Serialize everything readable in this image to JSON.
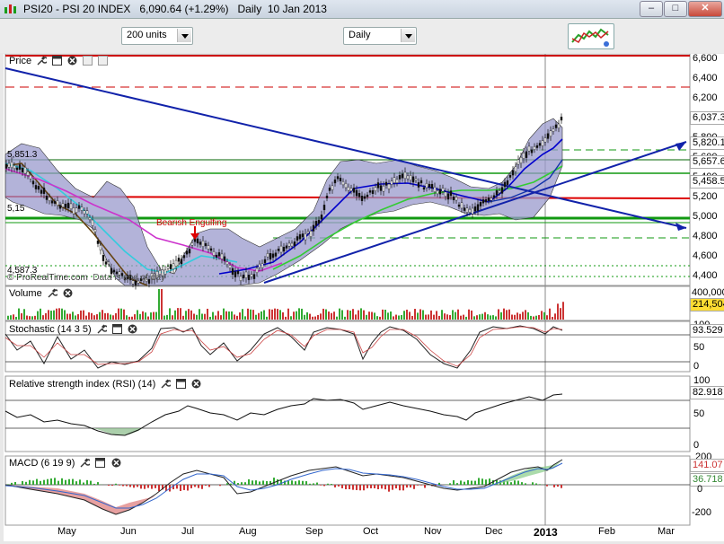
{
  "window": {
    "title": "PSI20 - PSI 20 INDEX",
    "last_price": "6,090.64",
    "change": "(+1.29%)",
    "period": "Daily",
    "date": "10 Jan 2013",
    "buttons": {
      "minimize": "–",
      "maximize": "□",
      "close": "✕"
    }
  },
  "toolbar": {
    "units_value": "200 units",
    "period_value": "Daily",
    "chart_type_icon": "chart-settings-icon"
  },
  "price_panel": {
    "label": "Price",
    "axis_ticks": [
      "6,600",
      "6,400",
      "6,200",
      "6,000",
      "5,800",
      "5,600",
      "5,400",
      "5,200",
      "5,000",
      "4,800",
      "4,600",
      "4,400"
    ],
    "badges": {
      "last": "6,037.3",
      "b1": "5,820.1",
      "b2": "5,657.6",
      "b3": "5,458.5"
    },
    "left_labels": {
      "top": "5,851.3",
      "mid": "5,15",
      "low": "4,587.3"
    },
    "annotation": "Bearish Engulfing",
    "watermark": "© ProRealTime.com",
    "watermark_tail": "Data is end of day"
  },
  "volume_panel": {
    "label": "Volume",
    "axis_ticks": [
      "400,000"
    ],
    "badge": "214,504"
  },
  "stochastic_panel": {
    "label": "Stochastic (14 3 5)",
    "axis_ticks": [
      "100",
      "50",
      "0"
    ],
    "badge": "93.529"
  },
  "rsi_panel": {
    "label": "Relative strength index (RSI) (14)",
    "axis_ticks": [
      "100",
      "50",
      "0"
    ],
    "badge": "82.918"
  },
  "macd_panel": {
    "label": "MACD (6 19 9)",
    "axis_ticks": [
      "200",
      "0",
      "-200"
    ],
    "badge1": "141.07",
    "badge2": "36.718"
  },
  "x_axis": [
    "May",
    "Jun",
    "Jul",
    "Aug",
    "Sep",
    "Oct",
    "Nov",
    "Dec",
    "2013",
    "Feb",
    "Mar"
  ],
  "colors": {
    "bollinger_fill": "#9999cc",
    "ma_fast": "#0000cc",
    "ma_cyan": "#33ccdd",
    "ma_magenta": "#cc33cc",
    "ma_green": "#33cc33",
    "ma_brown": "#664411",
    "support_red": "#dd0000",
    "support_green": "#119911",
    "trend_blue": "#1122aa"
  }
}
